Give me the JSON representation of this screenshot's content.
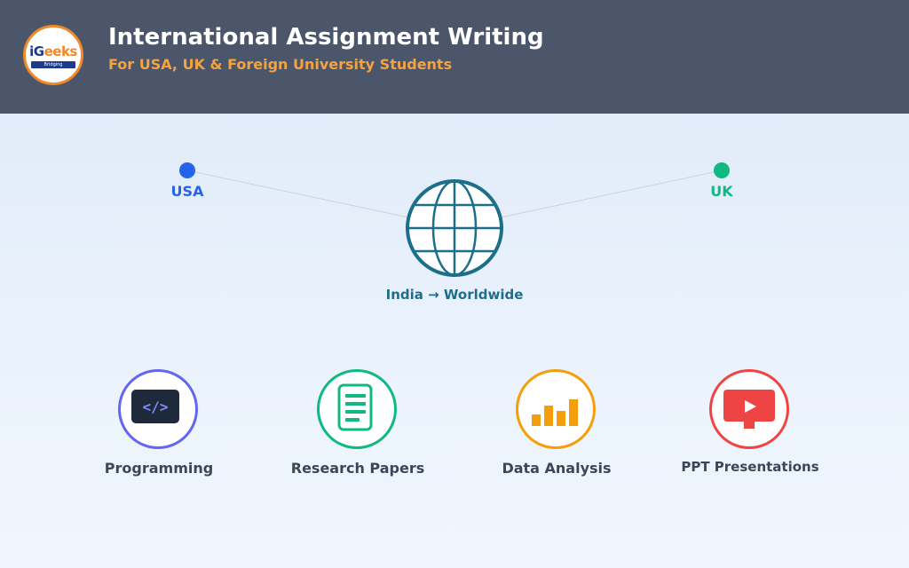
{
  "header": {
    "logo": {
      "text_main_1": "iG",
      "text_main_2": "eeks",
      "tagline": "Bridging Technology"
    },
    "title": "International Assignment Writing",
    "subtitle": "For USA, UK & Foreign University Students"
  },
  "map": {
    "locations": [
      {
        "label": "USA",
        "color": "#2563eb"
      },
      {
        "label": "UK",
        "color": "#10b981"
      }
    ],
    "globe_label": "India → Worldwide",
    "globe_color": "#1c6f8b"
  },
  "services": [
    {
      "label": "Programming",
      "icon": "code-icon",
      "color": "#6366f1"
    },
    {
      "label": "Research Papers",
      "icon": "document-icon",
      "color": "#10b981"
    },
    {
      "label": "Data Analysis",
      "icon": "bar-chart-icon",
      "color": "#f59e0b"
    },
    {
      "label": "PPT Presentations",
      "icon": "presentation-icon",
      "color": "#ef4444"
    }
  ]
}
